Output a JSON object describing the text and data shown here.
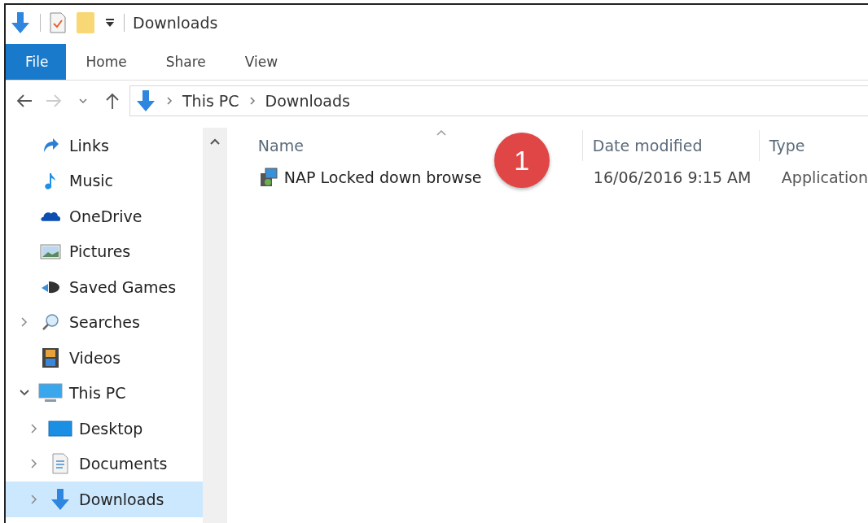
{
  "window": {
    "title": "Downloads"
  },
  "ribbon_tabs": [
    {
      "label": "File",
      "selected": true
    },
    {
      "label": "Home",
      "selected": false
    },
    {
      "label": "Share",
      "selected": false
    },
    {
      "label": "View",
      "selected": false
    }
  ],
  "address": {
    "crumbs": [
      "This PC",
      "Downloads"
    ]
  },
  "nav": [
    {
      "children": [
        {
          "label": "Links",
          "kind": "link",
          "expandable": false,
          "selected": false
        },
        {
          "label": "Music",
          "kind": "music",
          "expandable": false,
          "selected": false
        },
        {
          "label": "OneDrive",
          "kind": "cloud",
          "expandable": false,
          "selected": false
        },
        {
          "label": "Pictures",
          "kind": "pictures",
          "expandable": false,
          "selected": false
        },
        {
          "label": "Saved Games",
          "kind": "games",
          "expandable": false,
          "selected": false
        },
        {
          "label": "Searches",
          "kind": "search",
          "expandable": true,
          "expanded": false,
          "selected": false
        },
        {
          "label": "Videos",
          "kind": "videos",
          "expandable": false,
          "selected": false
        }
      ]
    },
    {
      "label": "This PC",
      "kind": "pc",
      "expandable": true,
      "expanded": true,
      "selected": false,
      "children": [
        {
          "label": "Desktop",
          "kind": "desktop",
          "expandable": true,
          "expanded": false,
          "selected": false
        },
        {
          "label": "Documents",
          "kind": "documents",
          "expandable": true,
          "expanded": false,
          "selected": false
        },
        {
          "label": "Downloads",
          "kind": "download",
          "expandable": true,
          "expanded": false,
          "selected": true
        }
      ]
    }
  ],
  "table": {
    "columns": [
      "Name",
      "Date modified",
      "Type"
    ],
    "rows": [
      {
        "name": "NAP Locked down browse",
        "date": "16/06/2016 9:15 AM",
        "type": "Application"
      }
    ]
  },
  "callout": {
    "number": "1"
  }
}
